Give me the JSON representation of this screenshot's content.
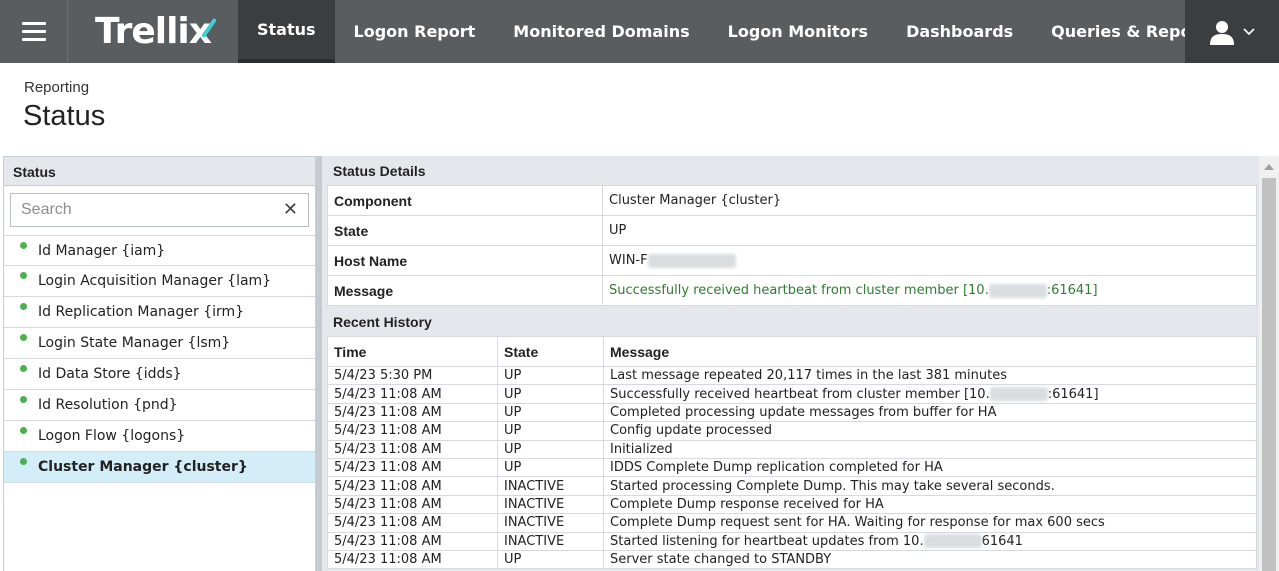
{
  "app": {
    "brand": "Trellix"
  },
  "nav": {
    "items": [
      {
        "label": "Status",
        "active": true
      },
      {
        "label": "Logon Report",
        "active": false
      },
      {
        "label": "Monitored Domains",
        "active": false
      },
      {
        "label": "Logon Monitors",
        "active": false
      },
      {
        "label": "Dashboards",
        "active": false
      },
      {
        "label": "Queries & Reports",
        "active": false
      }
    ]
  },
  "page": {
    "breadcrumb": "Reporting",
    "title": "Status"
  },
  "left_panel": {
    "header": "Status",
    "search_placeholder": "Search",
    "items": [
      {
        "label": "Id Manager {iam}",
        "status_color": "#4caf50",
        "selected": false
      },
      {
        "label": "Login Acquisition Manager {lam}",
        "status_color": "#4caf50",
        "selected": false
      },
      {
        "label": "Id Replication Manager {irm}",
        "status_color": "#4caf50",
        "selected": false
      },
      {
        "label": "Login State Manager {lsm}",
        "status_color": "#4caf50",
        "selected": false
      },
      {
        "label": "Id Data Store {idds}",
        "status_color": "#4caf50",
        "selected": false
      },
      {
        "label": "Id Resolution {pnd}",
        "status_color": "#4caf50",
        "selected": false
      },
      {
        "label": "Logon Flow {logons}",
        "status_color": "#4caf50",
        "selected": false
      },
      {
        "label": "Cluster Manager {cluster}",
        "status_color": "#4caf50",
        "selected": true
      }
    ]
  },
  "details": {
    "header": "Status Details",
    "rows": [
      {
        "key": "Component",
        "value": "Cluster Manager {cluster}"
      },
      {
        "key": "State",
        "value": "UP"
      },
      {
        "key": "Host Name",
        "value_prefix": "WIN-F"
      },
      {
        "key": "Message",
        "value_prefix": "Successfully received heartbeat from cluster member [10.",
        "value_suffix": ":61641]"
      }
    ]
  },
  "history": {
    "header": "Recent History",
    "columns": [
      "Time",
      "State",
      "Message"
    ],
    "rows": [
      {
        "time": "5/4/23 5:30 PM",
        "state": "UP",
        "message": "Last message repeated 20,117 times in the last 381 minutes"
      },
      {
        "time": "5/4/23 11:08 AM",
        "state": "UP",
        "message_prefix": "Successfully received heartbeat from cluster member [10.",
        "message_suffix": ":61641]"
      },
      {
        "time": "5/4/23 11:08 AM",
        "state": "UP",
        "message": "Completed processing update messages from buffer for HA"
      },
      {
        "time": "5/4/23 11:08 AM",
        "state": "UP",
        "message": "Config update processed"
      },
      {
        "time": "5/4/23 11:08 AM",
        "state": "UP",
        "message": "Initialized"
      },
      {
        "time": "5/4/23 11:08 AM",
        "state": "UP",
        "message": "IDDS Complete Dump replication completed for HA"
      },
      {
        "time": "5/4/23 11:08 AM",
        "state": "INACTIVE",
        "message": "Started processing Complete Dump. This may take several seconds."
      },
      {
        "time": "5/4/23 11:08 AM",
        "state": "INACTIVE",
        "message": "Complete Dump response received for HA"
      },
      {
        "time": "5/4/23 11:08 AM",
        "state": "INACTIVE",
        "message": "Complete Dump request sent for HA. Waiting for response for max 600 secs"
      },
      {
        "time": "5/4/23 11:08 AM",
        "state": "INACTIVE",
        "message_prefix": "Started listening for heartbeat updates from 10.",
        "message_suffix": "61641"
      },
      {
        "time": "5/4/23 11:08 AM",
        "state": "UP",
        "message": "Server state changed to STANDBY"
      }
    ]
  },
  "colors": {
    "nav_bg": "#595d60",
    "nav_active_bg": "#3b3e41",
    "selected_row_bg": "#d4eef9",
    "status_up_dot": "#4caf50",
    "message_green": "#2e7d32",
    "logo_accent": "#3fd0d4"
  },
  "icons": {
    "menu": "hamburger-icon",
    "user": "user-icon",
    "dropdown": "chevron-down-icon",
    "clear": "close-icon"
  }
}
